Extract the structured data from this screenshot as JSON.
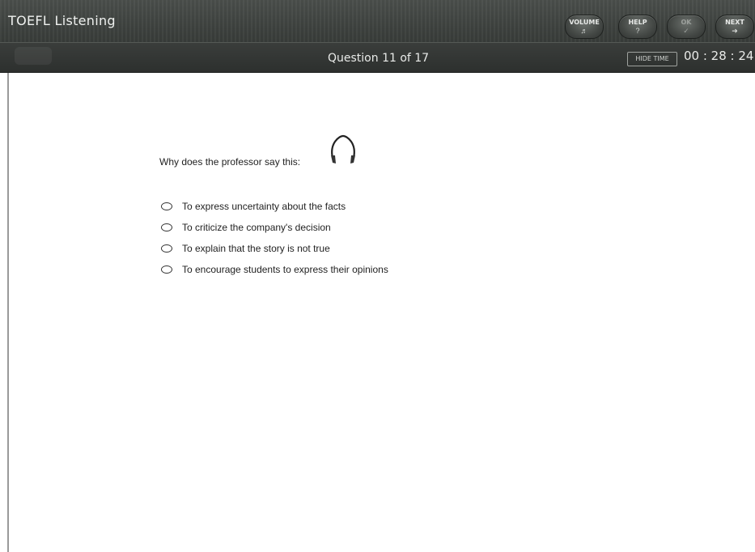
{
  "header": {
    "app_title": "TOEFL Listening",
    "question_counter": "Question 11 of 17",
    "hide_time_label": "HIDE TIME",
    "timer": "00 : 28 : 24"
  },
  "toolbar": {
    "volume_label": "VOLUME",
    "help_label": "HELP",
    "ok_label": "OK",
    "next_label": "NEXT"
  },
  "question": {
    "prompt": "Why does the professor say this:",
    "options": [
      {
        "label": "To express uncertainty about the facts",
        "selected": false
      },
      {
        "label": "To criticize the company's decision",
        "selected": false
      },
      {
        "label": "To explain that the story is not true",
        "selected": false
      },
      {
        "label": "To encourage students to express their opinions",
        "selected": false
      }
    ]
  },
  "icons": {
    "headphones": "headphones-icon",
    "volume": "speaker-icon",
    "help": "question-mark-icon",
    "ok": "checkmark-icon",
    "next": "arrow-right-icon"
  },
  "colors": {
    "header_bg": "#3b3f3c",
    "header_text": "#eef0ee",
    "content_bg": "#ffffff"
  }
}
